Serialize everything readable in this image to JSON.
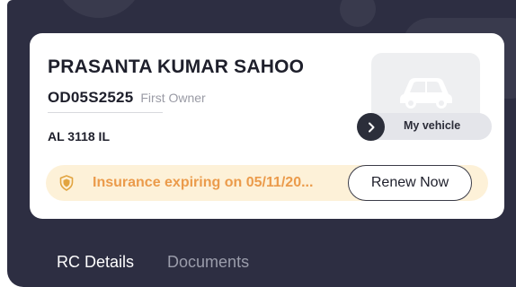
{
  "vehicle_card": {
    "owner_name": "PRASANTA KUMAR SAHOO",
    "registration_number": "OD05S2525",
    "owner_type": "First Owner",
    "model_code": "AL 3118 IL",
    "vehicle_label": "My vehicle",
    "vehicle_image_icon": "car-icon"
  },
  "insurance": {
    "message": "Insurance expiring on 05/11/20...",
    "icon": "shield-icon",
    "renew_label": "Renew Now"
  },
  "tabs": [
    {
      "label": "RC Details",
      "active": true
    },
    {
      "label": "Documents",
      "active": false
    }
  ],
  "colors": {
    "background_dark": "#2d2e42",
    "card": "#ffffff",
    "insurance_bg": "#fdf1d8",
    "insurance_text": "#eb9b4b",
    "tab_inactive": "#9b9dab"
  }
}
